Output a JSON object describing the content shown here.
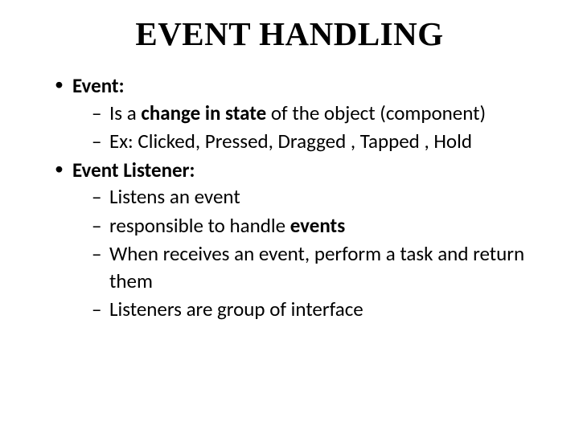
{
  "title": "EVENT HANDLING",
  "items": [
    {
      "label": "Event:",
      "bold": true,
      "children": [
        {
          "pre": "Is a ",
          "bold": "change in state",
          "post": " of the object (component)"
        },
        {
          "pre": "Ex: Clicked, Pressed, Dragged , Tapped , Hold",
          "bold": "",
          "post": ""
        }
      ]
    },
    {
      "label": "Event Listener:",
      "bold": true,
      "children": [
        {
          "pre": "Listens an event",
          "bold": "",
          "post": ""
        },
        {
          "pre": "responsible to handle ",
          "bold": "events",
          "post": ""
        },
        {
          "pre": "When receives an event, perform a task and return them",
          "bold": "",
          "post": ""
        },
        {
          "pre": "Listeners are group of interface",
          "bold": "",
          "post": ""
        }
      ]
    }
  ]
}
